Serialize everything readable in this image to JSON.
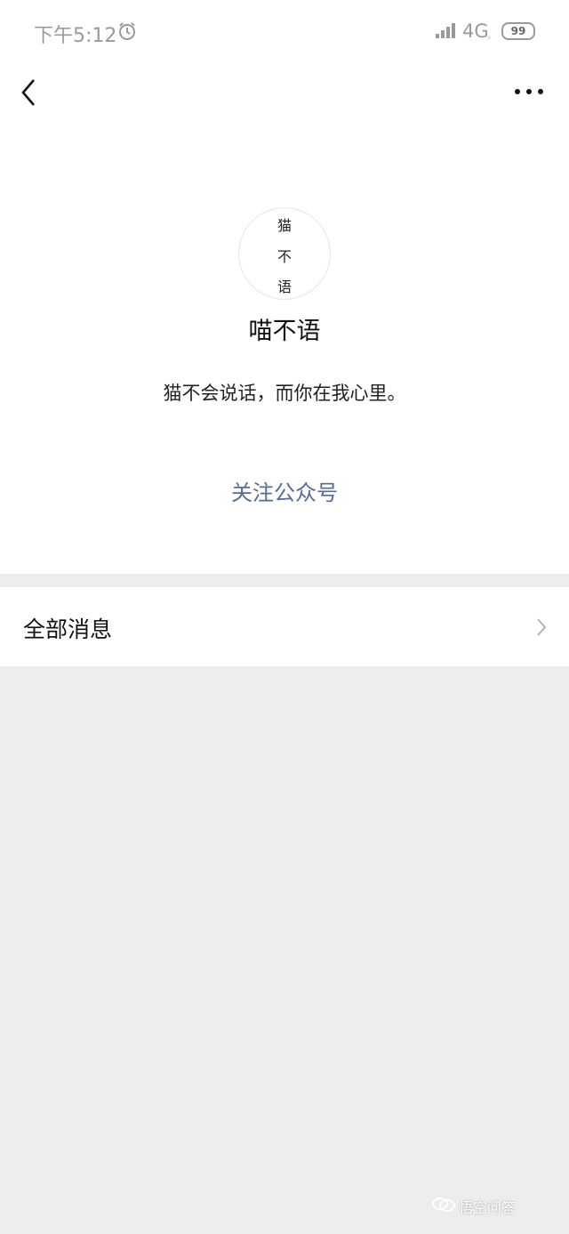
{
  "status_bar": {
    "time": "下午5:12",
    "alarm_icon": "alarm-icon",
    "network": "4G",
    "network_sub": "ᵢₗ",
    "battery": "99"
  },
  "header": {
    "back_icon": "chevron-left-icon",
    "more_icon": "more-dots-icon"
  },
  "profile": {
    "avatar_lines": [
      "猫",
      "不",
      "语"
    ],
    "name": "喵不语",
    "description": "猫不会说话，而你在我心里。",
    "follow_label": "关注公众号",
    "accent_color": "#576b95"
  },
  "list": {
    "all_messages_label": "全部消息"
  },
  "watermark": {
    "text": "悟空问答"
  }
}
